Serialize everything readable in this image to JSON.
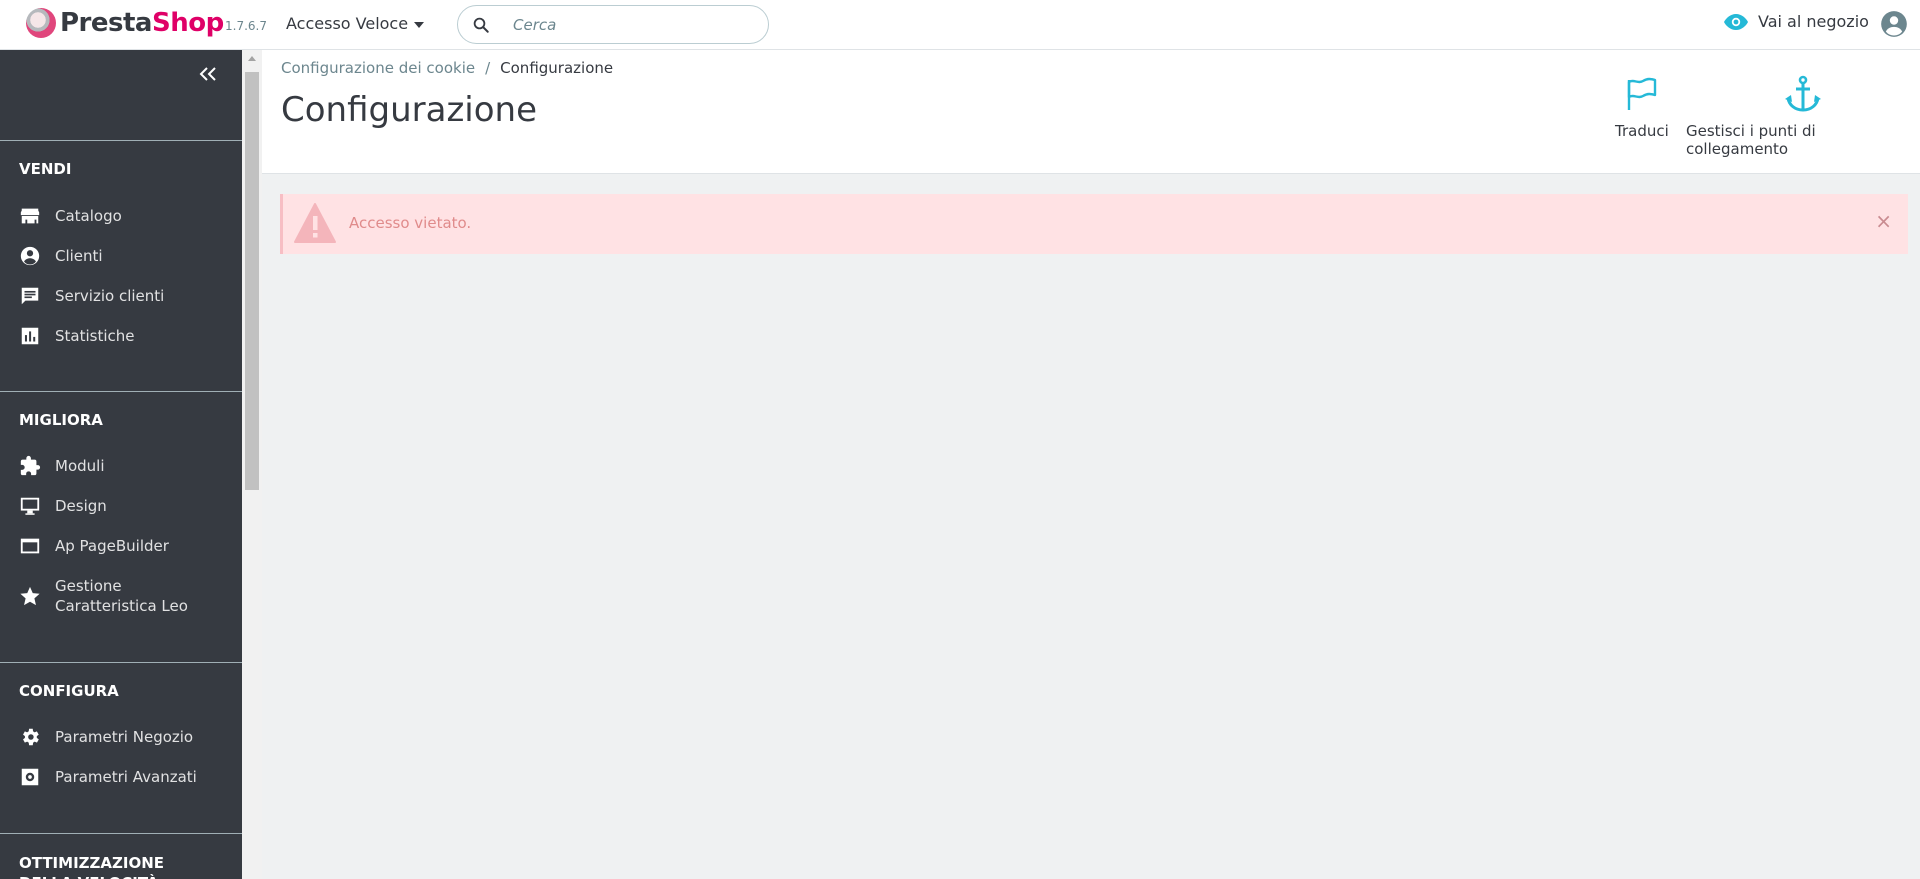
{
  "header": {
    "logo_presta": "Presta",
    "logo_shop": "Shop",
    "version": "1.7.6.7",
    "quick_access_label": "Accesso Veloce",
    "search_placeholder": "Cerca",
    "view_shop_label": "Vai al negozio"
  },
  "sidebar": {
    "sections": [
      {
        "title": "VENDI",
        "items": [
          {
            "label": "Catalogo",
            "icon": "store-icon"
          },
          {
            "label": "Clienti",
            "icon": "account-circle-icon"
          },
          {
            "label": "Servizio clienti",
            "icon": "chat-icon"
          },
          {
            "label": "Statistiche",
            "icon": "bar-chart-icon"
          }
        ]
      },
      {
        "title": "MIGLIORA",
        "items": [
          {
            "label": "Moduli",
            "icon": "puzzle-icon"
          },
          {
            "label": "Design",
            "icon": "desktop-icon"
          },
          {
            "label": "Ap PageBuilder",
            "icon": "web-asset-icon"
          },
          {
            "label": "Gestione Caratteristica Leo",
            "label_line1": "Gestione",
            "label_line2": "Caratteristica Leo",
            "icon": "star-icon"
          }
        ]
      },
      {
        "title": "CONFIGURA",
        "items": [
          {
            "label": "Parametri Negozio",
            "icon": "gear-icon"
          },
          {
            "label": "Parametri Avanzati",
            "icon": "settings-applications-icon"
          }
        ]
      },
      {
        "title": "OTTIMIZZAZIONE DELLA VELOCITÀ"
      }
    ]
  },
  "toolbar": {
    "breadcrumb_parent": "Configurazione dei cookie",
    "breadcrumb_separator": "/",
    "breadcrumb_current": "Configurazione",
    "page_title": "Configurazione",
    "translate_label": "Traduci",
    "hooks_label": "Gestisci i punti di collegamento"
  },
  "alert": {
    "message": "Accesso vietato.",
    "close_symbol": "×"
  },
  "colors": {
    "brand_pink": "#df0067",
    "sidebar_bg": "#363a41",
    "accent_cyan": "#25b9d7",
    "alert_bg": "#ffe2e4"
  }
}
